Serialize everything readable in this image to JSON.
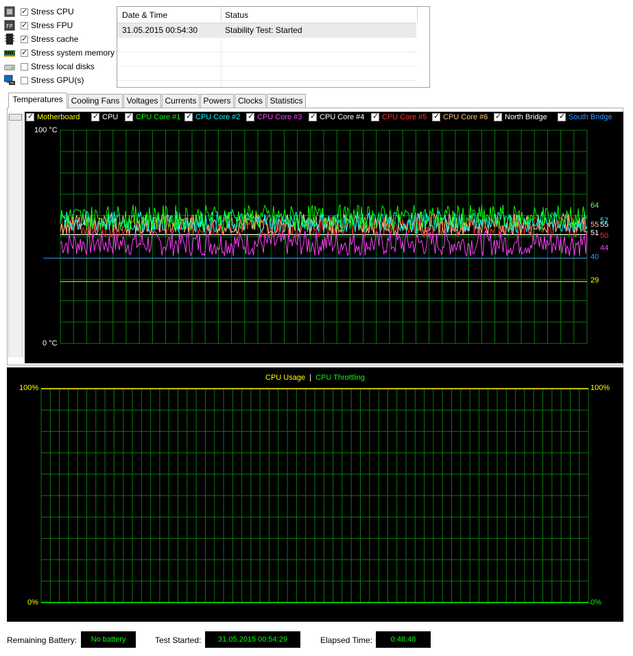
{
  "stress_options": [
    {
      "label": "Stress CPU",
      "checked": true,
      "icon": "cpu-chip-icon"
    },
    {
      "label": "Stress FPU",
      "checked": true,
      "icon": "fpu-chip-icon"
    },
    {
      "label": "Stress cache",
      "checked": true,
      "icon": "cache-chip-icon"
    },
    {
      "label": "Stress system memory",
      "checked": true,
      "icon": "memory-module-icon"
    },
    {
      "label": "Stress local disks",
      "checked": false,
      "icon": "hard-disk-icon"
    },
    {
      "label": "Stress GPU(s)",
      "checked": false,
      "icon": "monitor-gpu-icon"
    }
  ],
  "log": {
    "headers": [
      "Date & Time",
      "Status"
    ],
    "rows": [
      {
        "datetime": "31.05.2015 00:54:30",
        "status": "Stability Test: Started"
      }
    ]
  },
  "tabs": [
    "Temperatures",
    "Cooling Fans",
    "Voltages",
    "Currents",
    "Powers",
    "Clocks",
    "Statistics"
  ],
  "temperature_graph": {
    "legend": [
      {
        "label": "Motherboard",
        "color": "#ffff00"
      },
      {
        "label": "CPU",
        "color": "#ffffff"
      },
      {
        "label": "CPU Core #1",
        "color": "#00ff00"
      },
      {
        "label": "CPU Core #2",
        "color": "#00ffff"
      },
      {
        "label": "CPU Core #3",
        "color": "#ff40ff"
      },
      {
        "label": "CPU Core #4",
        "color": "#ffffff"
      },
      {
        "label": "CPU Core #5",
        "color": "#ff3030"
      },
      {
        "label": "CPU Core #6",
        "color": "#ffc080"
      },
      {
        "label": "North Bridge",
        "color": "#ffffff"
      },
      {
        "label": "South Bridge",
        "color": "#3399ff"
      }
    ],
    "y_max_label": "100 °C",
    "y_min_label": "0 °C",
    "end_values": [
      {
        "value": "64",
        "color": "#66ff66"
      },
      {
        "value": "57",
        "color": "#00ffff"
      },
      {
        "value": "55",
        "color": "#ffc080"
      },
      {
        "value": "55",
        "color": "#ffffff"
      },
      {
        "value": "51",
        "color": "#ffffff"
      },
      {
        "value": "50",
        "color": "#ff3030"
      },
      {
        "value": "44",
        "color": "#ff40ff"
      },
      {
        "value": "40",
        "color": "#3399ff"
      },
      {
        "value": "29",
        "color": "#ffff00"
      }
    ]
  },
  "usage_graph": {
    "legend_usage": "CPU Usage",
    "legend_sep": "|",
    "legend_throttle": "CPU Throttling",
    "left_max": "100%",
    "left_min": "0%",
    "right_max": "100%",
    "right_min": "0%",
    "usage_color": "#ffff00",
    "throttle_color": "#00ff00"
  },
  "status_bar": {
    "battery_label": "Remaining Battery:",
    "battery_value": "No battery",
    "started_label": "Test Started:",
    "started_value": "31.05.2015 00:54:29",
    "elapsed_label": "Elapsed Time:",
    "elapsed_value": "0:48:48"
  }
}
